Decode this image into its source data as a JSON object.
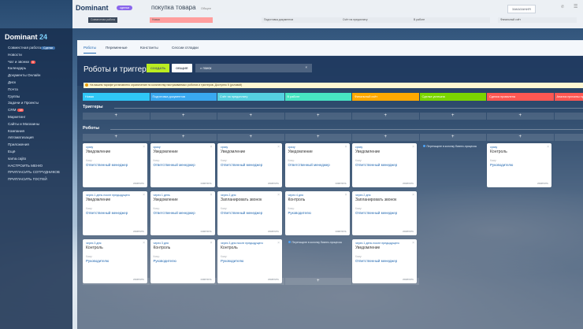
{
  "header": {
    "brand": "Dominant",
    "brand_button": "сделки",
    "deal_title": "покупка товара",
    "deal_subtitle": "Общее",
    "right_button": "ЗАКАЗАНИЯ",
    "stage_prefix": "Совместная работа",
    "stages": [
      "Новая",
      "Подготовка документов",
      "Счёт на предоплату",
      "В работе",
      "Финальный счёт"
    ]
  },
  "sidebar": {
    "logo": "Dominant",
    "logo_num": "24",
    "items": [
      {
        "label": "Совместная работа",
        "badge": "Сделки"
      },
      {
        "label": "Новости"
      },
      {
        "label": "Чат и звонки",
        "badge": "6"
      },
      {
        "label": "Календарь"
      },
      {
        "label": "Документы Онлайн"
      },
      {
        "label": "Диск"
      },
      {
        "label": "Почта"
      },
      {
        "label": "Группы"
      },
      {
        "label": "Задачи и Проекты"
      },
      {
        "label": "CRM",
        "badge": "18"
      },
      {
        "label": "Маркетинг"
      },
      {
        "label": "Сайты и Магазины"
      },
      {
        "label": "Компания"
      },
      {
        "label": "Автоматизация"
      },
      {
        "label": "Приложения"
      },
      {
        "label": "Ещё"
      },
      {
        "label": "sama.cajito"
      },
      {
        "label": "НАСТРОИТЬ МЕНЮ"
      },
      {
        "label": "ПРИГЛАСИТЬ СОТРУДНИКОВ"
      },
      {
        "label": "ПРИГЛАСИТЬ ГОСТЕЙ"
      }
    ]
  },
  "panel": {
    "tabs": [
      "Роботы",
      "Переменные",
      "Константы",
      "Сессии отладки"
    ],
    "title": "Роботы и триггеры",
    "create_button": "СОЗДАТЬ",
    "general_button": "ОБЩИЕ",
    "search_placeholder": "поиск",
    "warning": "На вашем тарифе установлено ограничение по количеству настраиваемых роботов и триггеров. Доступно 5 (условий)",
    "columns": [
      {
        "name": "Новая",
        "color": "#2fc6f6"
      },
      {
        "name": "Подготовка документов",
        "color": "#39a8ef"
      },
      {
        "name": "Счёт на предоплату",
        "color": "#55d0e0"
      },
      {
        "name": "В работе",
        "color": "#47e4c2"
      },
      {
        "name": "Финальный счёт",
        "color": "#ffa900"
      },
      {
        "name": "Сделка успешна",
        "color": "#7bd500"
      },
      {
        "name": "Сделка провалена",
        "color": "#ff5752"
      },
      {
        "name": "Анализ причины провала",
        "color": "#ff5752"
      }
    ],
    "triggers_label": "Триггеры",
    "robots_label": "Роботы",
    "add_symbol": "+",
    "cards": [
      {
        "col": 0,
        "row": 0,
        "cond": "сразу",
        "name": "Уведомление",
        "lbl": "Кому:",
        "val": "Ответственный менеджер"
      },
      {
        "col": 1,
        "row": 0,
        "cond": "сразу",
        "name": "Уведомление",
        "lbl": "Кому:",
        "val": "Ответственный менеджер"
      },
      {
        "col": 2,
        "row": 0,
        "cond": "сразу",
        "name": "Уведомление",
        "lbl": "Кому:",
        "val": "Ответственный менеджер"
      },
      {
        "col": 3,
        "row": 0,
        "cond": "сразу",
        "name": "Уведомление",
        "lbl": "Кому:",
        "val": "Ответственный менеджер"
      },
      {
        "col": 4,
        "row": 0,
        "cond": "сразу",
        "name": "Уведомление",
        "lbl": "Кому:",
        "val": "Ответственный менеджер"
      },
      {
        "col": 6,
        "row": 0,
        "cond": "сразу",
        "name": "Контроль",
        "lbl": "Кому:",
        "val": "Руководителю"
      },
      {
        "col": 0,
        "row": 1,
        "cond": "через 1 день после предыдущего",
        "name": "Уведомление",
        "lbl": "Кому:",
        "val": "Ответственный менеджер"
      },
      {
        "col": 1,
        "row": 1,
        "cond": "через 1 день",
        "name": "Уведомление",
        "lbl": "Кому:",
        "val": "Ответственный менеджер"
      },
      {
        "col": 2,
        "row": 1,
        "cond": "через 2 дня",
        "name": "Запланировать звонок",
        "lbl": "Кому:",
        "val": "Ответственный менеджер"
      },
      {
        "col": 3,
        "row": 1,
        "cond": "через 4 дня",
        "name": "Контроль",
        "lbl": "Кому:",
        "val": "Руководителю"
      },
      {
        "col": 4,
        "row": 1,
        "cond": "через 2 дня",
        "name": "Запланировать звонок",
        "lbl": "Кому:",
        "val": "Ответственный менеджер"
      },
      {
        "col": 0,
        "row": 2,
        "cond": "через 3 дня",
        "name": "Контроль",
        "lbl": "Кому:",
        "val": "Руководителю"
      },
      {
        "col": 1,
        "row": 2,
        "cond": "через 3 дня",
        "name": "Контроль",
        "lbl": "Кому:",
        "val": "Руководителю"
      },
      {
        "col": 2,
        "row": 2,
        "cond": "через 3 дня после предыдущего",
        "name": "Контроль",
        "lbl": "Кому:",
        "val": "Руководителю"
      },
      {
        "col": 4,
        "row": 2,
        "cond": "через 1 день после предыдущего",
        "name": "Уведомление",
        "lbl": "Кому:",
        "val": "Ответственный менеджер"
      }
    ],
    "card_edit": "изменить",
    "empty_notes": [
      {
        "col": 5,
        "row": 0,
        "text": "Перетащите в колонку бизнес-процессы"
      },
      {
        "col": 3,
        "row": 2,
        "text": "Перетащите в колонку бизнес-процессы"
      }
    ]
  }
}
